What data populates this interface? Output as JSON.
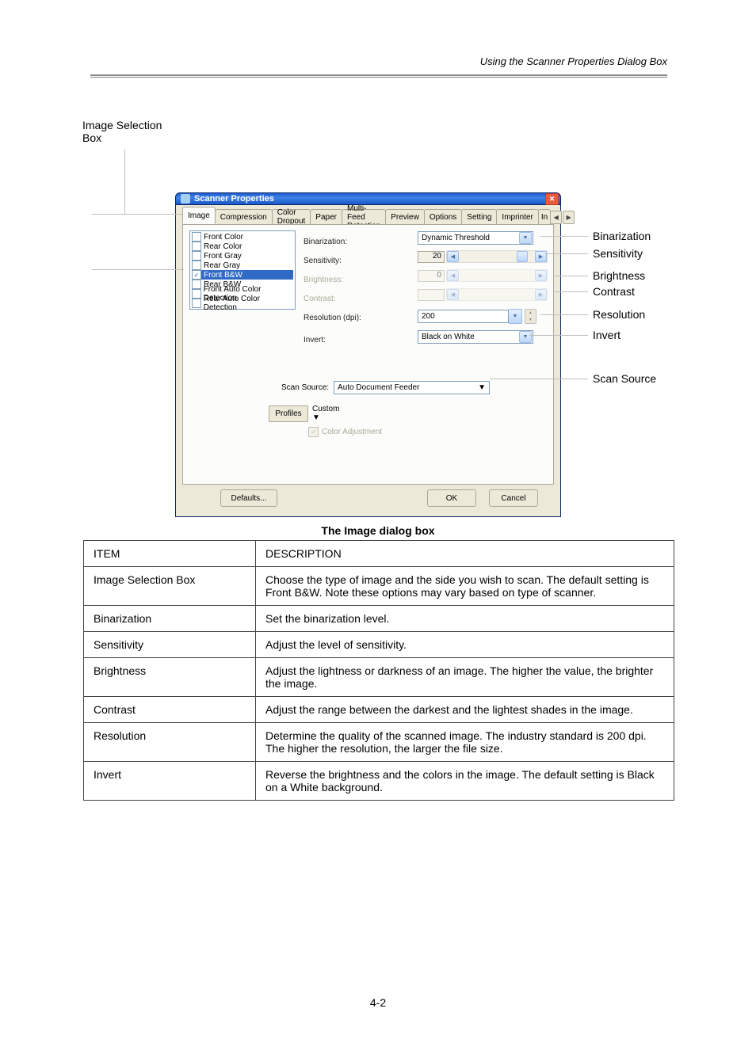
{
  "page": {
    "header_title": "Using the Scanner Properties Dialog Box",
    "dialog_title_en": "The Image dialog box",
    "footer": "4-2"
  },
  "dialog": {
    "title": "Scanner Properties",
    "tabs": [
      "Image",
      "Compression",
      "Color Dropout",
      "Paper",
      "Multi-Feed Detection",
      "Preview",
      "Options",
      "Setting",
      "Imprinter",
      "In"
    ],
    "active_tab": "Image",
    "selection_list": [
      {
        "label": "Front Color",
        "checked": false
      },
      {
        "label": "Rear Color",
        "checked": false
      },
      {
        "label": "Front Gray",
        "checked": false
      },
      {
        "label": "Rear Gray",
        "checked": false
      },
      {
        "label": "Front B&W",
        "checked": true,
        "selected": true
      },
      {
        "label": "Rear B&W",
        "checked": false
      },
      {
        "label": "Front Auto Color Detection",
        "checked": false
      },
      {
        "label": "Rear Auto Color Detection",
        "checked": false
      }
    ],
    "fields": {
      "binarization_label": "Binarization:",
      "binarization_value": "Dynamic Threshold",
      "sensitivity_label": "Sensitivity:",
      "sensitivity_value": "20",
      "brightness_label": "Brightness:",
      "brightness_value": "0",
      "contrast_label": "Contrast:",
      "resolution_label": "Resolution (dpi):",
      "resolution_value": "200",
      "invert_label": "Invert:",
      "invert_value": "Black on White",
      "scan_source_label": "Scan Source:",
      "scan_source_value": "Auto Document Feeder",
      "profiles_btn": "Profiles",
      "profiles_value": "Custom",
      "color_adjustment": "Color Adjustment"
    },
    "buttons": {
      "defaults": "Defaults...",
      "ok": "OK",
      "cancel": "Cancel"
    }
  },
  "callouts": {
    "image_selection": "Image Selection Box",
    "binarization": "Binarization",
    "sensitivity": "Sensitivity",
    "brightness": "Brightness",
    "contrast": "Contrast",
    "resolution": "Resolution",
    "invert": "Invert",
    "scan_source": "Scan Source"
  },
  "table": [
    {
      "item": "ITEM",
      "desc": "DESCRIPTION"
    },
    {
      "item": "Image Selection Box",
      "desc": "Choose the type of image and the side you wish to scan. The default setting is Front B&W. Note these options may vary based on type of scanner."
    },
    {
      "item": "Binarization",
      "desc": "Set the binarization level."
    },
    {
      "item": "Sensitivity",
      "desc": "Adjust the level of sensitivity."
    },
    {
      "item": "Brightness",
      "desc": "Adjust the lightness or darkness of an image. The higher the value, the brighter the image."
    },
    {
      "item": "Contrast",
      "desc": "Adjust the range between the darkest and the lightest shades in the image."
    },
    {
      "item": "Resolution",
      "desc": "Determine the quality of the scanned image. The industry standard is 200 dpi. The higher the resolution, the larger the file size."
    },
    {
      "item": "Invert",
      "desc": "Reverse the brightness and the colors in the image. The default setting is Black on a White background."
    }
  ]
}
